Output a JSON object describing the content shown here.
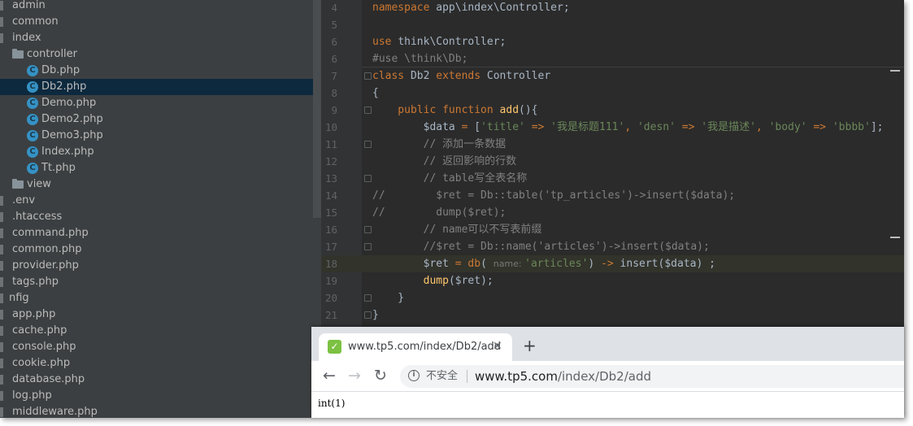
{
  "colors": {
    "tree_bg": "#3c3f41",
    "tree_selected": "#0d293e",
    "editor_bg": "#2b2b2b",
    "keyword": "#cc7832",
    "function": "#ffc66d",
    "string": "#6a8759",
    "comment": "#808080",
    "php_icon": "#3592c4"
  },
  "project_tree": {
    "items": [
      {
        "label": "admin",
        "type": "folder-partial"
      },
      {
        "label": "common",
        "type": "folder-partial"
      },
      {
        "label": "index",
        "type": "folder-partial"
      },
      {
        "label": "controller",
        "type": "folder"
      },
      {
        "label": "Db.php",
        "type": "php"
      },
      {
        "label": "Db2.php",
        "type": "php",
        "selected": true
      },
      {
        "label": "Demo.php",
        "type": "php"
      },
      {
        "label": "Demo2.php",
        "type": "php"
      },
      {
        "label": "Demo3.php",
        "type": "php"
      },
      {
        "label": "Index.php",
        "type": "php"
      },
      {
        "label": "Tt.php",
        "type": "php"
      },
      {
        "label": "view",
        "type": "folder"
      },
      {
        "label": ".env",
        "type": "file"
      },
      {
        "label": ".htaccess",
        "type": "file"
      },
      {
        "label": "command.php",
        "type": "file"
      },
      {
        "label": "common.php",
        "type": "file"
      },
      {
        "label": "provider.php",
        "type": "file"
      },
      {
        "label": "tags.php",
        "type": "file"
      },
      {
        "label": "nfig",
        "type": "folder-partial"
      },
      {
        "label": "app.php",
        "type": "file"
      },
      {
        "label": "cache.php",
        "type": "file"
      },
      {
        "label": "console.php",
        "type": "file"
      },
      {
        "label": "cookie.php",
        "type": "file"
      },
      {
        "label": "database.php",
        "type": "file"
      },
      {
        "label": "log.php",
        "type": "file"
      },
      {
        "label": "middleware.php",
        "type": "file"
      }
    ]
  },
  "editor": {
    "lines": [
      {
        "no": "4",
        "tokens": [
          {
            "t": "namespace ",
            "c": "kw"
          },
          {
            "t": "app\\index\\Controller;",
            "c": "var"
          }
        ]
      },
      {
        "no": "5",
        "tokens": []
      },
      {
        "no": "6",
        "tokens": [
          {
            "t": "use ",
            "c": "kw"
          },
          {
            "t": "think\\Controller;",
            "c": "var"
          }
        ]
      },
      {
        "no": "6b",
        "label": "6",
        "tokens": [
          {
            "t": "#use \\think\\Db;",
            "c": "cmt"
          }
        ]
      },
      {
        "no": "7",
        "tokens": [
          {
            "t": "class ",
            "c": "kw"
          },
          {
            "t": "Db2 ",
            "c": "var"
          },
          {
            "t": "extends ",
            "c": "kw"
          },
          {
            "t": "Controller",
            "c": "var"
          }
        ]
      },
      {
        "no": "8",
        "tokens": [
          {
            "t": "{",
            "c": "var"
          }
        ]
      },
      {
        "no": "9",
        "tokens": [
          {
            "t": "    public function ",
            "c": "kw"
          },
          {
            "t": "add",
            "c": "fn"
          },
          {
            "t": "(){",
            "c": "var"
          }
        ]
      },
      {
        "no": "10",
        "tokens": [
          {
            "t": "        $data ",
            "c": "var"
          },
          {
            "t": "= ",
            "c": "kw"
          },
          {
            "t": "[",
            "c": "var"
          },
          {
            "t": "'title' ",
            "c": "str"
          },
          {
            "t": "=> ",
            "c": "kw"
          },
          {
            "t": "'我是标题111'",
            "c": "str"
          },
          {
            "t": ", ",
            "c": "kw"
          },
          {
            "t": "'desn' ",
            "c": "str"
          },
          {
            "t": "=> ",
            "c": "kw"
          },
          {
            "t": "'我是描述'",
            "c": "str"
          },
          {
            "t": ", ",
            "c": "kw"
          },
          {
            "t": "'body' ",
            "c": "str"
          },
          {
            "t": "=> ",
            "c": "kw"
          },
          {
            "t": "'bbbb'",
            "c": "str"
          },
          {
            "t": "];",
            "c": "var"
          }
        ]
      },
      {
        "no": "11",
        "tokens": [
          {
            "t": "        // 添加一条数据",
            "c": "cmt"
          }
        ]
      },
      {
        "no": "12",
        "tokens": [
          {
            "t": "        // 返回影响的行数",
            "c": "cmt"
          }
        ]
      },
      {
        "no": "13",
        "tokens": [
          {
            "t": "        // table写全表名称",
            "c": "cmt"
          }
        ]
      },
      {
        "no": "14",
        "tokens": [
          {
            "t": "//        $ret = Db::table('tp_articles')->insert($data);",
            "c": "cmt"
          }
        ]
      },
      {
        "no": "15",
        "tokens": [
          {
            "t": "//        dump($ret);",
            "c": "cmt"
          }
        ]
      },
      {
        "no": "16",
        "tokens": [
          {
            "t": "        // name可以不写表前缀",
            "c": "cmt"
          }
        ]
      },
      {
        "no": "17",
        "tokens": [
          {
            "t": "        //$ret = Db::name('articles')->insert($data);",
            "c": "cmt"
          }
        ]
      },
      {
        "no": "18",
        "tokens": [
          {
            "t": "        $ret ",
            "c": "var"
          },
          {
            "t": "= ",
            "c": "kw"
          },
          {
            "t": "db",
            "c": "kw"
          },
          {
            "t": "( ",
            "c": "var"
          },
          {
            "t": "name: ",
            "c": "hint"
          },
          {
            "t": "'articles'",
            "c": "str"
          },
          {
            "t": ") ",
            "c": "var"
          },
          {
            "t": "-> ",
            "c": "kw"
          },
          {
            "t": "insert",
            "c": "var"
          },
          {
            "t": "($data) ;",
            "c": "var"
          }
        ],
        "current": true
      },
      {
        "no": "19",
        "tokens": [
          {
            "t": "        ",
            "c": "var"
          },
          {
            "t": "dump",
            "c": "fn"
          },
          {
            "t": "($ret);",
            "c": "var"
          }
        ]
      },
      {
        "no": "20",
        "tokens": [
          {
            "t": "    }",
            "c": "var"
          }
        ]
      },
      {
        "no": "21",
        "tokens": [
          {
            "t": "}",
            "c": "var"
          }
        ]
      }
    ]
  },
  "browser": {
    "tab_title": "www.tp5.com/index/Db2/add",
    "tab_close": "✕",
    "new_tab": "+",
    "back": "←",
    "forward": "→",
    "reload": "↻",
    "info_icon": "i",
    "security_label": "不安全",
    "url_host": "www.tp5.com",
    "url_path": "/index/Db2/add",
    "page_output": "int(1)"
  }
}
